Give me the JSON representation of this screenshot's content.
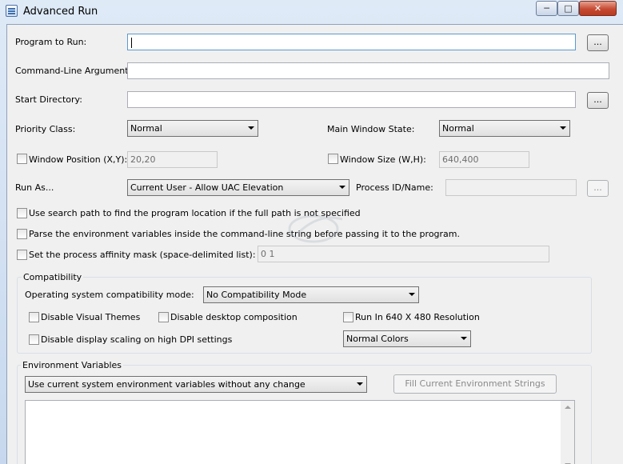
{
  "window": {
    "title": "Advanced Run"
  },
  "program": {
    "label": "Program to Run:",
    "value": "",
    "browse": "..."
  },
  "args": {
    "label": "Command-Line Arguments:",
    "value": ""
  },
  "startdir": {
    "label": "Start Directory:",
    "value": "",
    "browse": "..."
  },
  "priority": {
    "label": "Priority Class:",
    "value": "Normal"
  },
  "mainwin": {
    "label": "Main Window State:",
    "value": "Normal"
  },
  "winpos": {
    "label": "Window Position (X,Y):",
    "value": "20,20"
  },
  "winsize": {
    "label": "Window Size (W,H):",
    "value": "640,400"
  },
  "runas": {
    "label": "Run As...",
    "value": "Current User - Allow UAC Elevation"
  },
  "procid": {
    "label": "Process ID/Name:",
    "value": "",
    "browse": "..."
  },
  "options": {
    "search_path": "Use search path to find the program location if the full path is not specified",
    "parse_env": "Parse the environment variables inside the command-line string before passing it to the program.",
    "affinity": "Set the process affinity mask (space-delimited list):",
    "affinity_value": "0 1"
  },
  "compat": {
    "title": "Compatibility",
    "mode_label": "Operating system compatibility mode:",
    "mode_value": "No Compatibility Mode",
    "disable_themes": "Disable Visual Themes",
    "disable_composition": "Disable desktop composition",
    "run_640": "Run In 640 X 480 Resolution",
    "disable_dpi": "Disable display scaling on high DPI settings",
    "colors_value": "Normal Colors"
  },
  "env": {
    "title": "Environment Variables",
    "mode_value": "Use current system environment variables without any change",
    "fill_button": "Fill Current Environment Strings"
  }
}
